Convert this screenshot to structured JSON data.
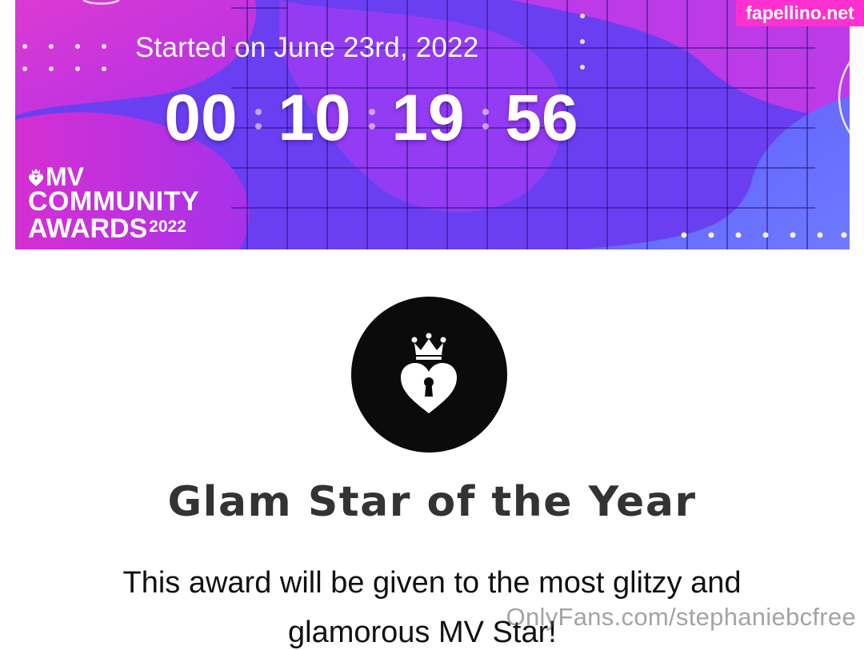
{
  "banner": {
    "started_text": "Started on June 23rd, 2022",
    "countdown": [
      "00",
      "10",
      "19",
      "56"
    ],
    "logo": {
      "line1": "MV",
      "line2": "COMMUNITY",
      "line3": "AWARDS",
      "year": "2022"
    },
    "colors": {
      "purple": "#6b3cf0",
      "magenta": "#d12fd6",
      "blue": "#5b6cff"
    }
  },
  "watermark_top": "fapellino.net",
  "award": {
    "icon": "crowned-heart-lock-icon",
    "title": "Glam Star of the Year",
    "description": "This award will be given to the most glitzy and",
    "description_line2": "glamorous MV Star!"
  },
  "watermark_bottom": "OnlyFans.com/stephaniebcfree"
}
